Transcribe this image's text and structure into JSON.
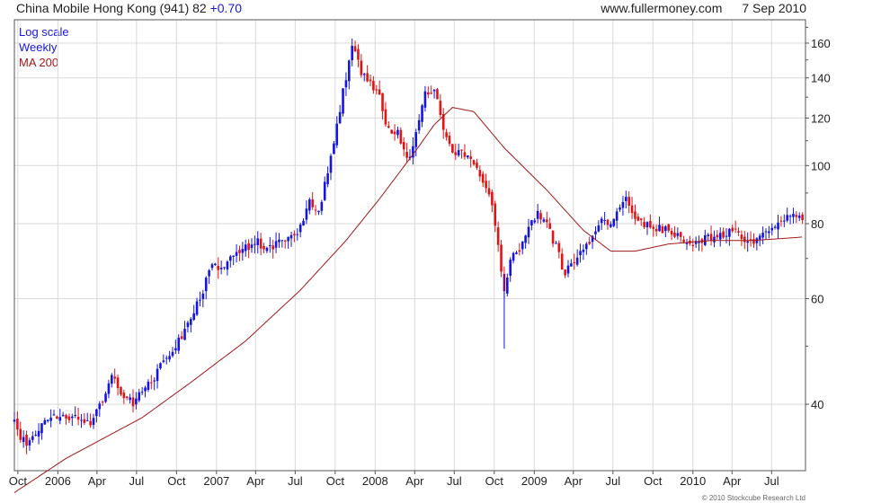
{
  "header": {
    "security": "China Mobile Hong Kong (941) 82",
    "change": "+0.70",
    "source": "www.fullermoney.com",
    "date": "7 Sep 2010"
  },
  "legend": {
    "scale": "Log scale",
    "period": "Weekly",
    "ma": "MA 200"
  },
  "copyright": "© 2010 Stockcube Research Ltd",
  "colors": {
    "up": "#1515e0",
    "down": "#e01414",
    "ma": "#a01818",
    "grid": "#d9d9d9",
    "frame": "#555555"
  },
  "chart_data": {
    "type": "candlestick",
    "y_scale": "log",
    "ylim": [
      31,
      175
    ],
    "y_ticks": [
      40,
      60,
      80,
      100,
      120,
      140,
      160
    ],
    "x_ticks": [
      "Oct",
      "2006",
      "Apr",
      "Jul",
      "Oct",
      "2007",
      "Apr",
      "Jul",
      "Oct",
      "2008",
      "Apr",
      "Jul",
      "Oct",
      "2009",
      "Apr",
      "Jul",
      "Oct",
      "2010",
      "Apr",
      "Jul"
    ],
    "x_tick_dates": [
      "2005-10-01",
      "2006-01-01",
      "2006-04-01",
      "2006-07-01",
      "2006-10-01",
      "2007-01-01",
      "2007-04-01",
      "2007-07-01",
      "2007-10-01",
      "2008-01-01",
      "2008-04-01",
      "2008-07-01",
      "2008-10-01",
      "2009-01-01",
      "2009-04-01",
      "2009-07-01",
      "2009-10-01",
      "2010-01-01",
      "2010-04-01",
      "2010-07-01"
    ],
    "x_range": [
      "2005-09-23",
      "2010-09-17"
    ],
    "close_anchors": [
      [
        "2005-09-23",
        37.5
      ],
      [
        "2005-10-10",
        35
      ],
      [
        "2005-10-28",
        34.5
      ],
      [
        "2005-11-25",
        37.5
      ],
      [
        "2005-12-23",
        38
      ],
      [
        "2006-01-20",
        38.5
      ],
      [
        "2006-02-17",
        37.5
      ],
      [
        "2006-03-17",
        37
      ],
      [
        "2006-04-07",
        40
      ],
      [
        "2006-05-05",
        44.5
      ],
      [
        "2006-05-26",
        41.5
      ],
      [
        "2006-06-23",
        40
      ],
      [
        "2006-07-14",
        42
      ],
      [
        "2006-08-11",
        44.5
      ],
      [
        "2006-09-08",
        48
      ],
      [
        "2006-10-06",
        51
      ],
      [
        "2006-11-03",
        55
      ],
      [
        "2006-12-01",
        62
      ],
      [
        "2006-12-22",
        68
      ],
      [
        "2007-01-19",
        67
      ],
      [
        "2007-02-16",
        72
      ],
      [
        "2007-03-09",
        73
      ],
      [
        "2007-04-06",
        75
      ],
      [
        "2007-04-27",
        72
      ],
      [
        "2007-05-18",
        74
      ],
      [
        "2007-06-15",
        75
      ],
      [
        "2007-07-13",
        79
      ],
      [
        "2007-08-03",
        88
      ],
      [
        "2007-08-24",
        84
      ],
      [
        "2007-09-14",
        97
      ],
      [
        "2007-10-05",
        118
      ],
      [
        "2007-10-26",
        140
      ],
      [
        "2007-11-09",
        158
      ],
      [
        "2007-11-30",
        143
      ],
      [
        "2007-12-21",
        138
      ],
      [
        "2008-01-11",
        130
      ],
      [
        "2008-02-01",
        114
      ],
      [
        "2008-02-22",
        113
      ],
      [
        "2008-03-14",
        102
      ],
      [
        "2008-04-04",
        112
      ],
      [
        "2008-04-25",
        132
      ],
      [
        "2008-05-16",
        133
      ],
      [
        "2008-06-06",
        116
      ],
      [
        "2008-06-27",
        106
      ],
      [
        "2008-07-25",
        104
      ],
      [
        "2008-08-15",
        102
      ],
      [
        "2008-09-05",
        95
      ],
      [
        "2008-09-26",
        85
      ],
      [
        "2008-10-10",
        73
      ],
      [
        "2008-10-24",
        62
      ],
      [
        "2008-11-07",
        70
      ],
      [
        "2008-11-28",
        72
      ],
      [
        "2008-12-19",
        80
      ],
      [
        "2009-01-09",
        83
      ],
      [
        "2009-01-30",
        80
      ],
      [
        "2009-02-20",
        73
      ],
      [
        "2009-03-13",
        66
      ],
      [
        "2009-04-03",
        70
      ],
      [
        "2009-04-24",
        72
      ],
      [
        "2009-05-15",
        77
      ],
      [
        "2009-06-05",
        82
      ],
      [
        "2009-06-26",
        80
      ],
      [
        "2009-07-17",
        85
      ],
      [
        "2009-07-31",
        88
      ],
      [
        "2009-08-21",
        82
      ],
      [
        "2009-09-11",
        80
      ],
      [
        "2009-10-09",
        79
      ],
      [
        "2009-11-06",
        78
      ],
      [
        "2009-12-04",
        76
      ],
      [
        "2010-01-01",
        74
      ],
      [
        "2010-01-22",
        75
      ],
      [
        "2010-02-12",
        76
      ],
      [
        "2010-03-12",
        77
      ],
      [
        "2010-04-02",
        78
      ],
      [
        "2010-04-30",
        75
      ],
      [
        "2010-05-21",
        74
      ],
      [
        "2010-06-11",
        77
      ],
      [
        "2010-07-02",
        78
      ],
      [
        "2010-07-23",
        80
      ],
      [
        "2010-08-13",
        82
      ],
      [
        "2010-09-03",
        82
      ]
    ],
    "ma_200_anchors": [
      [
        "2005-09-23",
        28.5
      ],
      [
        "2006-01-20",
        32.5
      ],
      [
        "2006-07-14",
        38
      ],
      [
        "2006-11-03",
        43.5
      ],
      [
        "2007-03-09",
        51
      ],
      [
        "2007-07-13",
        62
      ],
      [
        "2007-10-26",
        75
      ],
      [
        "2008-01-11",
        88
      ],
      [
        "2008-04-04",
        106
      ],
      [
        "2008-05-16",
        117
      ],
      [
        "2008-06-27",
        125
      ],
      [
        "2008-08-15",
        123
      ],
      [
        "2008-10-24",
        107
      ],
      [
        "2009-01-30",
        91
      ],
      [
        "2009-04-24",
        78
      ],
      [
        "2009-06-26",
        72
      ],
      [
        "2009-08-21",
        72
      ],
      [
        "2009-11-06",
        74
      ],
      [
        "2010-02-12",
        75
      ],
      [
        "2010-05-21",
        75
      ],
      [
        "2010-09-10",
        76
      ]
    ],
    "xlabel": "",
    "ylabel": ""
  }
}
